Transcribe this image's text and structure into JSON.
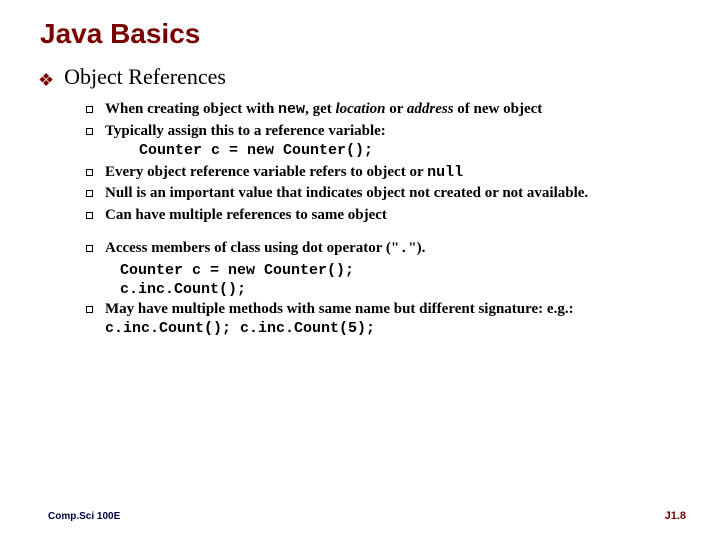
{
  "title": "Java Basics",
  "subtitle": "Object References",
  "items": {
    "b1a": "When creating object with ",
    "b1_new": "new",
    "b1b": ", get ",
    "b1_loc": "location",
    "b1c": " or ",
    "b1_addr": "address",
    "b1d": " of new object",
    "b2": "Typically assign this to a reference variable:",
    "b2_code": "Counter c = new Counter();",
    "b3a": "Every object reference variable refers to object or ",
    "b3_null": "null",
    "b4": "Null is an important value that indicates object not created or not available.",
    "b5": "Can have multiple references to same object",
    "b6a": "Access members of class using dot operator (\"",
    "b6_dot": ".",
    "b6b": "\").",
    "b6_code1": "Counter c = new Counter();",
    "b6_code2": "c.inc.Count();",
    "b7a": "May have multiple methods with same name but different signature: e.g.: ",
    "b7_code": "c.inc.Count(); c.inc.Count(5);"
  },
  "footer": {
    "left": "Comp.Sci 100E",
    "right": "J1.8"
  }
}
